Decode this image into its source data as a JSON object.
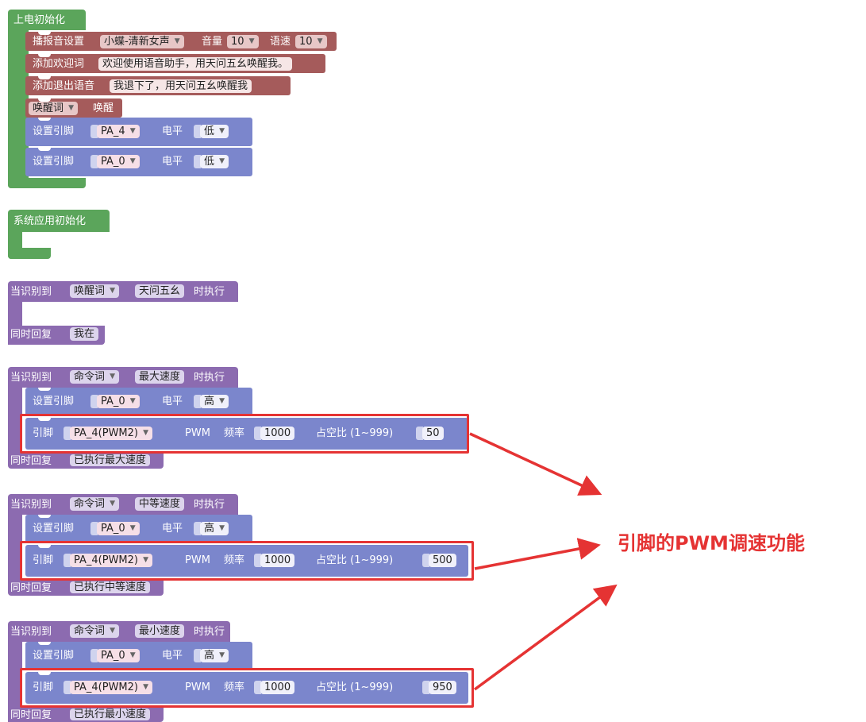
{
  "startup": {
    "title": "上电初始化",
    "voice_label": "播报音设置",
    "voice_value": "小蝶-清新女声",
    "volume_label": "音量",
    "volume_value": "10",
    "speed_label": "语速",
    "speed_value": "10",
    "welcome_label": "添加欢迎词",
    "welcome_value": "欢迎使用语音助手，用天问五幺唤醒我。",
    "exit_label": "添加退出语音",
    "exit_value": "我退下了，用天问五幺唤醒我",
    "wake_dropdown": "唤醒词",
    "wake_label": "唤醒",
    "pin_rows": [
      {
        "label": "设置引脚",
        "pin": "PA_4",
        "level_label": "电平",
        "level": "低"
      },
      {
        "label": "设置引脚",
        "pin": "PA_0",
        "level_label": "电平",
        "level": "低"
      }
    ]
  },
  "sysinit": {
    "title": "系统应用初始化"
  },
  "wake_event": {
    "when_label": "当识别到",
    "type": "唤醒词",
    "word": "天问五幺",
    "exec_label": "时执行",
    "reply_label": "同时回复",
    "reply": "我在"
  },
  "commands": [
    {
      "when_label": "当识别到",
      "type": "命令词",
      "word": "最大速度",
      "exec_label": "时执行",
      "set_label": "设置引脚",
      "set_pin": "PA_0",
      "level_label": "电平",
      "level": "高",
      "pwm_label": "引脚",
      "pwm_pin": "PA_4(PWM2)",
      "pwm_text": "PWM",
      "freq_label": "频率",
      "freq": "1000",
      "duty_label": "占空比 (1~999)",
      "duty": "50",
      "reply_label": "同时回复",
      "reply": "已执行最大速度"
    },
    {
      "when_label": "当识别到",
      "type": "命令词",
      "word": "中等速度",
      "exec_label": "时执行",
      "set_label": "设置引脚",
      "set_pin": "PA_0",
      "level_label": "电平",
      "level": "高",
      "pwm_label": "引脚",
      "pwm_pin": "PA_4(PWM2)",
      "pwm_text": "PWM",
      "freq_label": "频率",
      "freq": "1000",
      "duty_label": "占空比 (1~999)",
      "duty": "500",
      "reply_label": "同时回复",
      "reply": "已执行中等速度"
    },
    {
      "when_label": "当识别到",
      "type": "命令词",
      "word": "最小速度",
      "exec_label": "时执行",
      "set_label": "设置引脚",
      "set_pin": "PA_0",
      "level_label": "电平",
      "level": "高",
      "pwm_label": "引脚",
      "pwm_pin": "PA_4(PWM2)",
      "pwm_text": "PWM",
      "freq_label": "频率",
      "freq": "1000",
      "duty_label": "占空比 (1~999)",
      "duty": "950",
      "reply_label": "同时回复",
      "reply": "已执行最小速度"
    }
  ],
  "annotation": {
    "text": "引脚的PWM调速功能",
    "color": "#e53333"
  },
  "colors": {
    "event_green": "#5ba55b",
    "event_purple": "#8c6bb0",
    "voice_brown": "#a55b5b",
    "gpio_blue": "#7b86cc",
    "highlight_red": "#e53333"
  }
}
